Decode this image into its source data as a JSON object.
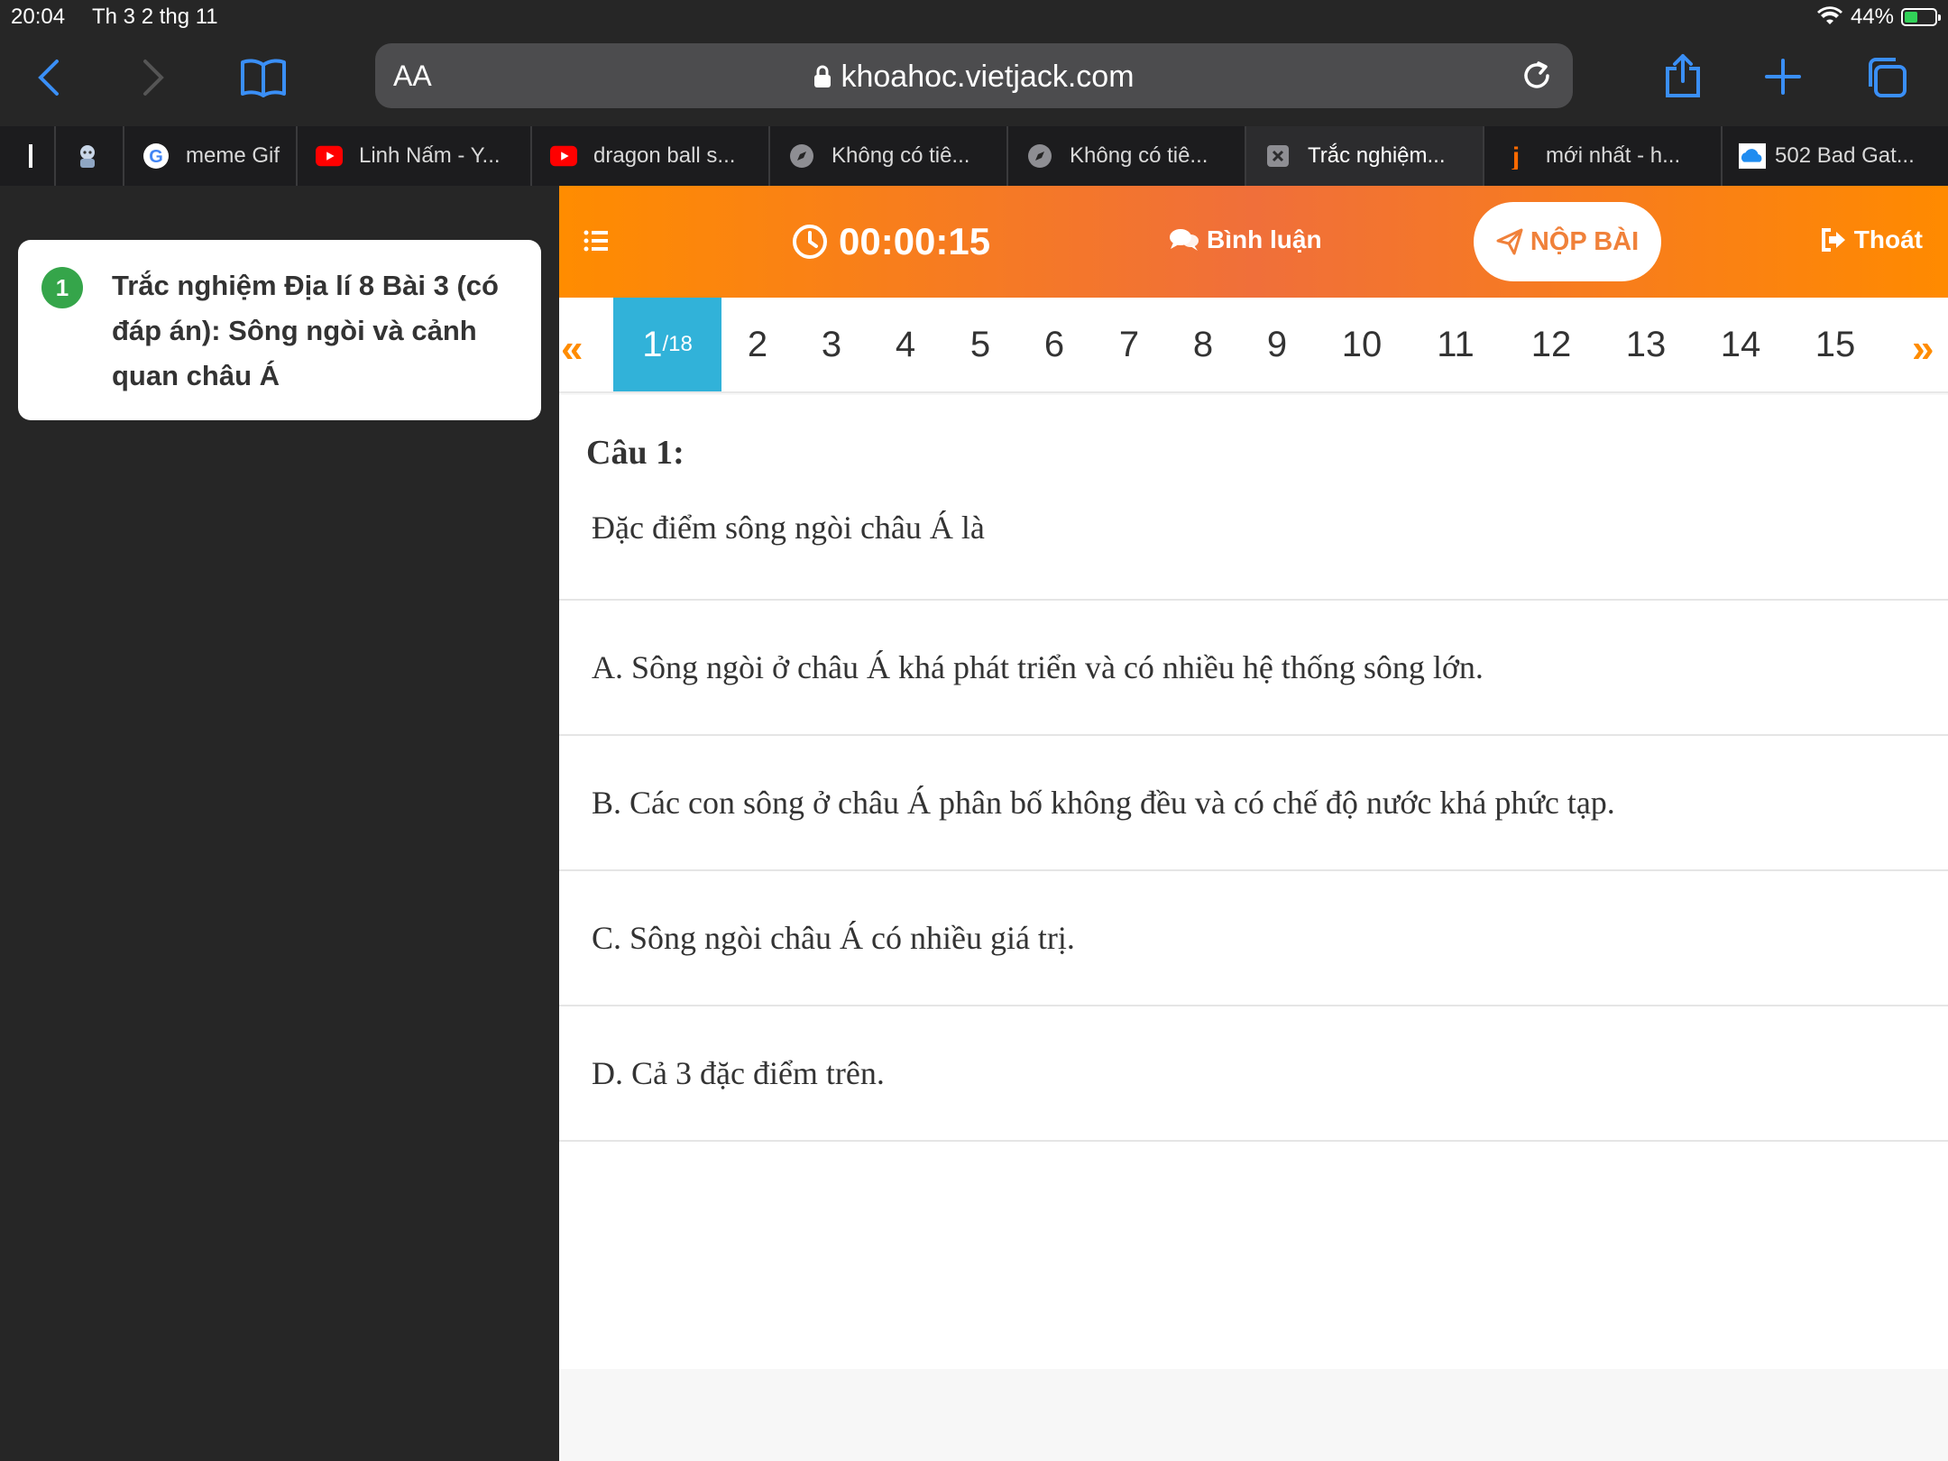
{
  "status": {
    "time": "20:04",
    "date": "Th 3 2 thg 11",
    "battery": "44%",
    "battery_fraction": 0.44
  },
  "browser": {
    "text_size_label": "AA",
    "url": "khoahoc.vietjack.com",
    "tabs": [
      {
        "label": "",
        "icon": "blank-icon"
      },
      {
        "label": "",
        "icon": "character-icon"
      },
      {
        "label": "meme Gif",
        "icon": "google-icon"
      },
      {
        "label": "Linh Nấm - Y...",
        "icon": "youtube-icon"
      },
      {
        "label": "dragon ball s...",
        "icon": "youtube-icon"
      },
      {
        "label": "Không có tiê...",
        "icon": "compass-icon"
      },
      {
        "label": "Không có tiê...",
        "icon": "compass-icon"
      },
      {
        "label": "Trắc nghiệm...",
        "icon": "close-icon"
      },
      {
        "label": "mới nhất - h...",
        "icon": "j-icon"
      },
      {
        "label": "502 Bad Gat...",
        "icon": "cloud-icon"
      }
    ]
  },
  "sidebar": {
    "lesson": {
      "number": "1",
      "title": "Trắc nghiệm Địa lí 8 Bài 3 (có đáp án): Sông ngòi và cảnh quan châu Á"
    }
  },
  "quiz": {
    "timer": "00:00:15",
    "comment_label": "Bình luận",
    "submit_label": "NỘP BÀI",
    "exit_label": "Thoát",
    "current": "1",
    "total": "/18",
    "numbers": [
      "2",
      "3",
      "4",
      "5",
      "6",
      "7",
      "8",
      "9",
      "10",
      "11",
      "12",
      "13",
      "14",
      "15"
    ],
    "question_label": "Câu 1:",
    "question_text": "Đặc điểm sông ngòi châu Á là",
    "options": [
      "A. Sông ngòi ở châu Á khá phát triển và có nhiều hệ thống sông lớn.",
      "B. Các con sông ở châu Á phân bố không đều và có chế độ nước khá phức tạp.",
      "C. Sông ngòi châu Á có nhiều giá trị.",
      "D. Cả 3 đặc điểm trên."
    ]
  },
  "colors": {
    "accent_orange": "#ff8c00",
    "current_question": "#31b2d9",
    "lesson_badge": "#35a54a",
    "browser_blue": "#3a8ff7"
  }
}
